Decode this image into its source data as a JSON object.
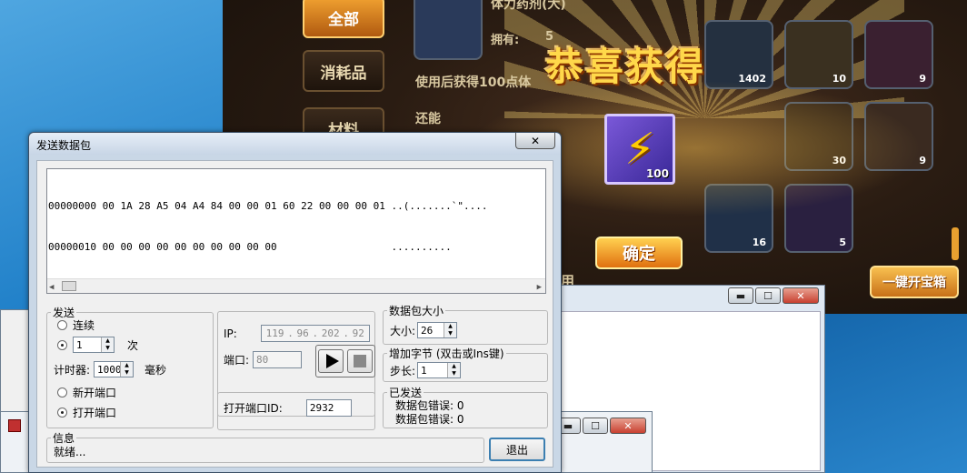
{
  "game": {
    "tabs": [
      "全部",
      "消耗品",
      "材料"
    ],
    "item_name": "体力药剂(大)",
    "owned_label": "拥有:",
    "owned_count": "5",
    "desc_line1": "使用后获得100点体",
    "desc_line2": "还能",
    "congrats": "恭喜获得",
    "reward_count": "100",
    "confirm": "确定",
    "open_all": "一键开宝箱",
    "slot_counts": [
      "1402",
      "10",
      "9",
      "30",
      "9",
      "16",
      "5"
    ],
    "partial_text": "用"
  },
  "dialog": {
    "title": "发送数据包",
    "close": "✕",
    "hex_lines": [
      "00000000 00 1A 28 A5 04 A4 84 00 00 01 60 22 00 00 00 01 ..(.......`\"....",
      "00000010 00 00 00 00 00 00 00 00 00 00                   .........."
    ],
    "send": {
      "legend": "发送",
      "continuous": "连续",
      "count_value": "1",
      "count_unit": "次",
      "timer_label": "计时器:",
      "timer_value": "1000",
      "timer_unit": "毫秒",
      "new_port": "新开端口",
      "open_port": "打开端口"
    },
    "ip_label": "IP:",
    "ip_parts": [
      "119",
      "96",
      "202",
      "92"
    ],
    "port_label": "端口:",
    "port_value": "80",
    "open_port_id_label": "打开端口ID:",
    "open_port_id_value": "2932",
    "pkt_size": {
      "legend": "数据包大小",
      "size_label": "大小:",
      "size_value": "26"
    },
    "add_bytes": {
      "legend": "增加字节 (双击或Ins键)",
      "step_label": "步长:",
      "step_value": "1"
    },
    "sent": {
      "legend": "已发送",
      "err1": "数据包错误: 0",
      "err2": "数据包错误: 0"
    },
    "info": {
      "legend": "信息",
      "text": "就绪..."
    },
    "exit": "退出"
  },
  "bgwin2": {
    "min": "▬",
    "max": "☐",
    "close": "✕"
  }
}
